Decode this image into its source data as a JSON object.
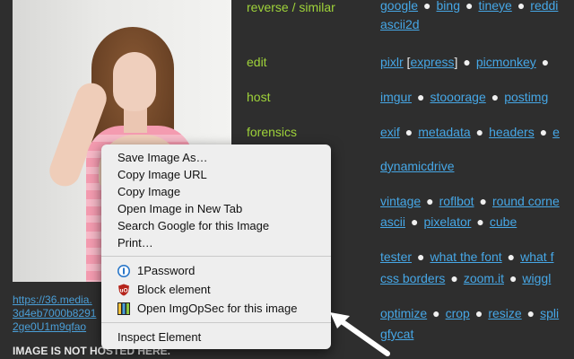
{
  "left_panel": {
    "image_url_line1": "https://36.media.",
    "image_url_line2": "3d4eb7000b8291",
    "image_url_line3": "2ge0U1m9qfao",
    "not_hosted_text": "IMAGE IS NOT HOSTED HERE."
  },
  "categories": [
    {
      "label": "reverse / similar"
    },
    {
      "label": "edit"
    },
    {
      "label": "host"
    },
    {
      "label": "forensics"
    }
  ],
  "rows": {
    "reverse": [
      "google",
      "bing",
      "tineye",
      "reddi"
    ],
    "reverse_wrap": "ascii2d",
    "edit": {
      "pixlr": "pixlr",
      "express": "express",
      "picmonkey": "picmonkey"
    },
    "host": [
      "imgur",
      "stooorage",
      "postimg"
    ],
    "forensics": [
      "exif",
      "metadata",
      "headers"
    ],
    "dynamic": "dynamicdrive",
    "fun1": [
      "vintage",
      "roflbot",
      "round corne"
    ],
    "fun2": [
      "ascii",
      "pixelator",
      "cube"
    ],
    "font": [
      "tester",
      "what the font",
      "what f"
    ],
    "css": [
      "css borders",
      "zoom.it",
      "wiggl"
    ],
    "optimize": [
      "optimize",
      "crop",
      "resize",
      "spli"
    ],
    "gfycat": "gfycat"
  },
  "context_menu": {
    "save_image_as": "Save Image As…",
    "copy_image_url": "Copy Image URL",
    "copy_image": "Copy Image",
    "open_in_new_tab": "Open Image in New Tab",
    "search_google": "Search Google for this Image",
    "print": "Print…",
    "onepassword": "1Password",
    "block_element": "Block element",
    "open_imgopsec": "Open ImgOpSec for this image",
    "inspect_element": "Inspect Element"
  },
  "colors": {
    "background": "#2e2e2e",
    "category_green": "#9fd33a",
    "link_blue": "#46a7e6",
    "menu_bg": "#eeeeee"
  },
  "icons": [
    "onepassword-icon",
    "ublock-icon",
    "imgopsec-icon",
    "arrow-pointer-icon"
  ]
}
